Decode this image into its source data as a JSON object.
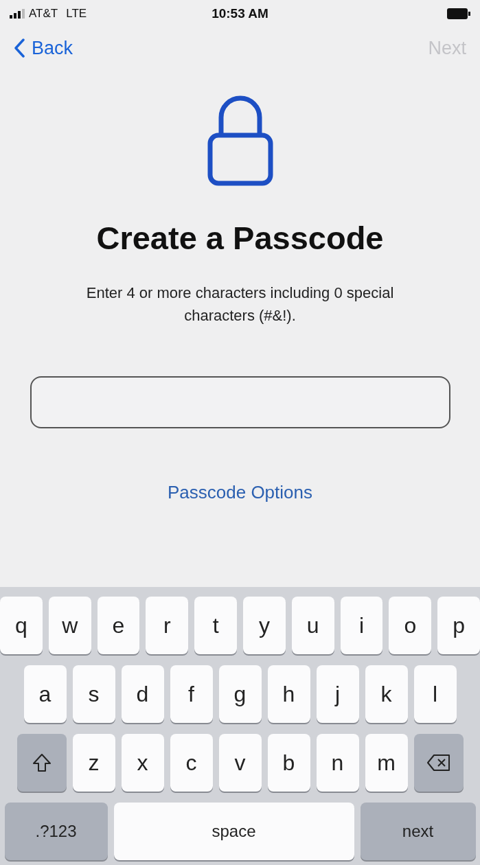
{
  "status_bar": {
    "carrier": "AT&T",
    "network": "LTE",
    "time": "10:53 AM"
  },
  "nav": {
    "back": "Back",
    "next": {
      "label": "Next",
      "disabled": true
    }
  },
  "title": "Create a Passcode",
  "subtitle": "Enter 4 or more characters including 0 special characters (#&!).",
  "options_link": "Passcode Options",
  "keyboard": {
    "rows": [
      [
        {
          "kind": "letter",
          "label": "q"
        },
        {
          "kind": "letter",
          "label": "w"
        },
        {
          "kind": "letter",
          "label": "e"
        },
        {
          "kind": "letter",
          "label": "r"
        },
        {
          "kind": "letter",
          "label": "t"
        },
        {
          "kind": "letter",
          "label": "y"
        },
        {
          "kind": "letter",
          "label": "u"
        },
        {
          "kind": "letter",
          "label": "i"
        },
        {
          "kind": "letter",
          "label": "o"
        },
        {
          "kind": "letter",
          "label": "p"
        }
      ],
      [
        {
          "kind": "letter",
          "label": "a"
        },
        {
          "kind": "letter",
          "label": "s"
        },
        {
          "kind": "letter",
          "label": "d"
        },
        {
          "kind": "letter",
          "label": "f"
        },
        {
          "kind": "letter",
          "label": "g"
        },
        {
          "kind": "letter",
          "label": "h"
        },
        {
          "kind": "letter",
          "label": "j"
        },
        {
          "kind": "letter",
          "label": "k"
        },
        {
          "kind": "letter",
          "label": "l"
        }
      ],
      [
        {
          "kind": "shift"
        },
        {
          "kind": "letter",
          "label": "z"
        },
        {
          "kind": "letter",
          "label": "x"
        },
        {
          "kind": "letter",
          "label": "c"
        },
        {
          "kind": "letter",
          "label": "v"
        },
        {
          "kind": "letter",
          "label": "b"
        },
        {
          "kind": "letter",
          "label": "n"
        },
        {
          "kind": "letter",
          "label": "m"
        },
        {
          "kind": "delete"
        }
      ]
    ],
    "bottom_bar": {
      "mode_key": ".?123",
      "space_key": "space",
      "return_key": "next"
    }
  }
}
